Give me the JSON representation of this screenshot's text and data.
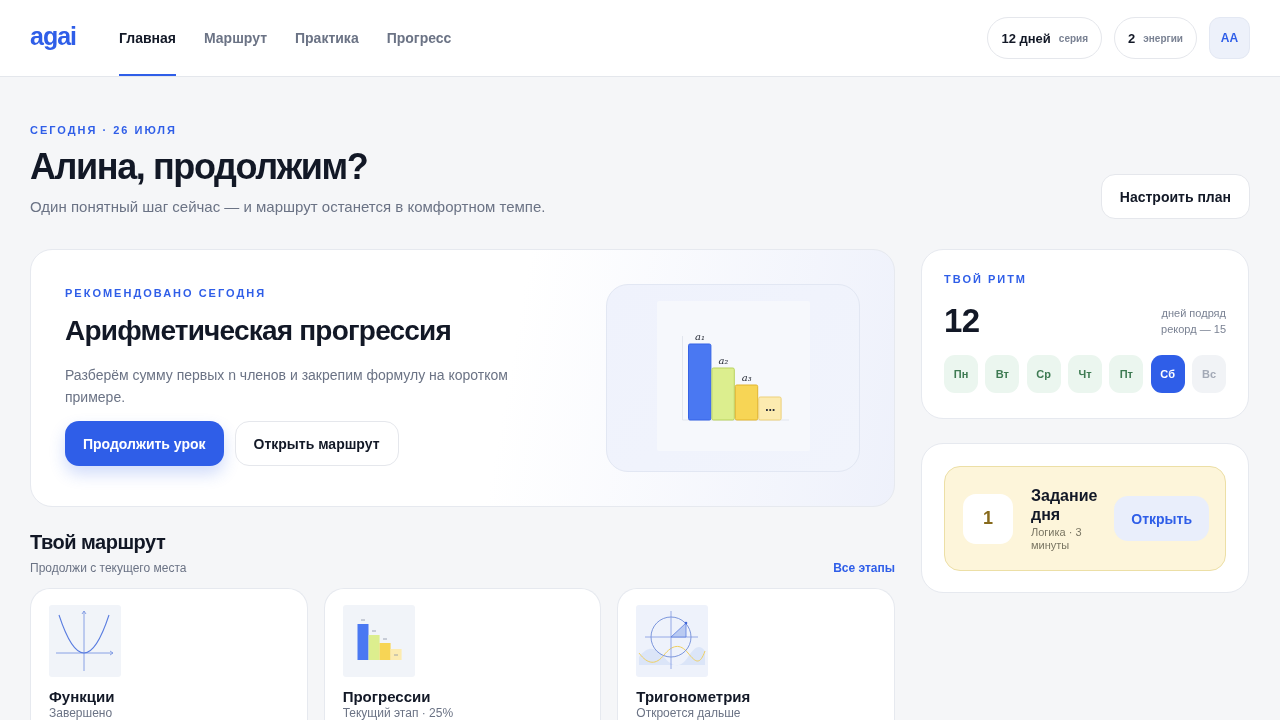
{
  "header": {
    "logo": "agai",
    "nav": [
      {
        "label": "Главная",
        "selected": true
      },
      {
        "label": "Маршрут",
        "selected": false
      },
      {
        "label": "Практика",
        "selected": false
      },
      {
        "label": "Прогресс",
        "selected": false
      }
    ],
    "stats": [
      {
        "value": "12 дней",
        "label": "серия"
      },
      {
        "value": "2",
        "label": "энергии"
      }
    ],
    "avatar": "АА"
  },
  "page_header": {
    "eyebrow": "СЕГОДНЯ · 26 ИЮЛЯ",
    "title": "Алина, продолжим?",
    "subtitle": "Один понятный шаг сейчас — и маршрут останется в комфортном темпе.",
    "action": "Настроить план"
  },
  "recommended": {
    "eyebrow": "РЕКОМЕНДОВАНО СЕГОДНЯ",
    "title": "Арифметическая прогрессия",
    "description": "Разберём сумму первых n членов и закрепим формулу на коротком примере.",
    "buttons": [
      {
        "label": "Продолжить урок",
        "kind": "primary"
      },
      {
        "label": "Открыть маршрут",
        "kind": "secondary"
      }
    ],
    "illustration": {
      "labels": [
        "a₁",
        "a₂",
        "a₃",
        "…"
      ]
    }
  },
  "rhythm": {
    "eyebrow": "ТВОЙ РИТМ",
    "count": "12",
    "unit": "дней подряд",
    "record": "рекорд — 15",
    "days": [
      {
        "label": "Пн",
        "done": true,
        "selected": false
      },
      {
        "label": "Вт",
        "done": true,
        "selected": false
      },
      {
        "label": "Ср",
        "done": true,
        "selected": false
      },
      {
        "label": "Чт",
        "done": true,
        "selected": false
      },
      {
        "label": "Пт",
        "done": true,
        "selected": false
      },
      {
        "label": "Сб",
        "done": false,
        "selected": true
      },
      {
        "label": "Вс",
        "done": false,
        "selected": false
      }
    ]
  },
  "daily_task": {
    "number": "1",
    "title": "Задание дня",
    "meta": "Логика · 3 минуты",
    "button": "Открыть"
  },
  "route": {
    "title": "Твой маршрут",
    "subtitle": "Продолжи с текущего места",
    "link": "Все этапы",
    "cards": [
      {
        "kind": "parabola",
        "title": "Функции",
        "status": "Завершено"
      },
      {
        "kind": "bars",
        "title": "Прогрессии",
        "status": "Текущий этап · 25%"
      },
      {
        "kind": "unit_circle",
        "title": "Тригонометрия",
        "status": "Откроется дальше"
      }
    ]
  }
}
